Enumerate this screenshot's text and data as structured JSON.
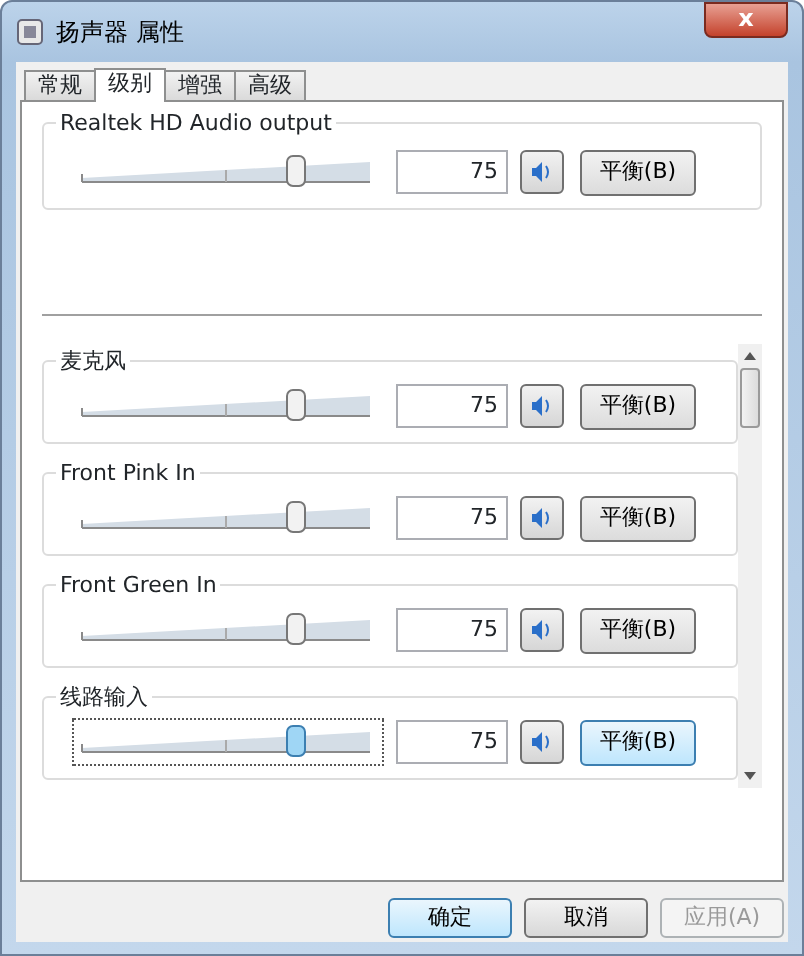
{
  "window": {
    "title": "扬声器 属性",
    "close": "x"
  },
  "tabs": [
    {
      "label": "常规",
      "selected": false
    },
    {
      "label": "级别",
      "selected": true
    },
    {
      "label": "增强",
      "selected": false
    },
    {
      "label": "高级",
      "selected": false
    }
  ],
  "output": {
    "name": "Realtek HD Audio output",
    "level": 0.75,
    "reading": "75",
    "muted": false,
    "balance": "平衡(B)",
    "focused": false
  },
  "inputs": [
    {
      "name": "麦克风",
      "level": 0.75,
      "reading": "75",
      "muted": false,
      "balance": "平衡(B)",
      "focused": false
    },
    {
      "name": "Front Pink In",
      "level": 0.75,
      "reading": "75",
      "muted": false,
      "balance": "平衡(B)",
      "focused": false
    },
    {
      "name": "Front Green In",
      "level": 0.75,
      "reading": "75",
      "muted": false,
      "balance": "平衡(B)",
      "focused": false
    },
    {
      "name": "线路输入",
      "level": 0.75,
      "reading": "75",
      "muted": false,
      "balance": "平衡(B)",
      "focused": true
    }
  ],
  "buttons": [
    {
      "label": "确定",
      "disabled": false,
      "default": true
    },
    {
      "label": "取消",
      "disabled": false,
      "default": false
    },
    {
      "label": "应用(A)",
      "disabled": true,
      "default": false
    }
  ]
}
